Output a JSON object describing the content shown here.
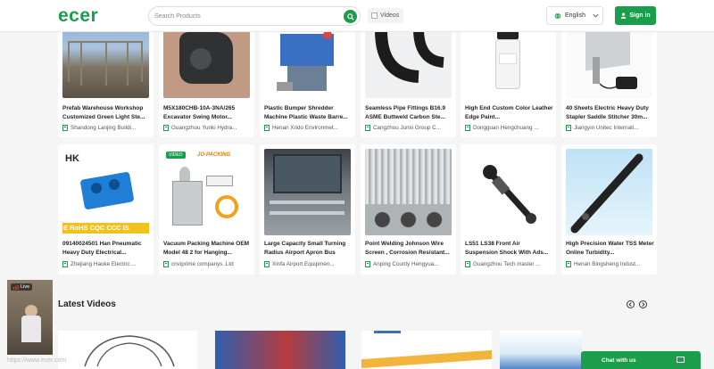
{
  "header": {
    "logo": "ecer",
    "search_placeholder": "Search Products",
    "videos_label": "Videos",
    "language": "English",
    "signin_label": "Sign in"
  },
  "products": [
    {
      "title": "Prefab Warehouse Workshop Customized Green Light Ste...",
      "supplier": "Shandong Lanjing Buildi..."
    },
    {
      "title": "M5X180CHB-10A-3NA/265 Excavator Swing Motor...",
      "supplier": "Guangzhou Yunki Hydra..."
    },
    {
      "title": "Plastic Bumper Shredder Machine Plastic Waste Barre...",
      "supplier": "Henan Xrido Environmet..."
    },
    {
      "title": "Seamless Pipe Fittings B16.9 ASME Buttweld Carbon Ste...",
      "supplier": "Cangzhou Junxi Group C..."
    },
    {
      "title": "High End Custom Color Leather Edge Paint...",
      "supplier": "Dongguan Hengchuang ..."
    },
    {
      "title": "40 Sheets Electric Heavy Duty Stapler Saddle Stitcher 30m...",
      "supplier": "Jiangyin Unitec Internati..."
    },
    {
      "title": "09140024501 Han Pneumatic Heavy Duty Electrical...",
      "supplier": "Zhejiang Haoke Electric ...",
      "img_text": "E RoHS CQC CCC IS",
      "brand": "HK"
    },
    {
      "title": "Vacuum Packing Machine OEM Model 48 2 for Hanging...",
      "supplier": "cnviprime companys .Ltd",
      "badge": "VIDEO",
      "brand": "JO-PACKING"
    },
    {
      "title": "Large Capacity Small Turning Radius Airport Apron Bus",
      "supplier": "Xinfa Airport Equipmen..."
    },
    {
      "title": "Point Welding Johnson Wire Screen , Corrosion Resistant...",
      "supplier": "Anping County Hengyua..."
    },
    {
      "title": "LS51 LS38 Front Air Suspension Shock With Ads...",
      "supplier": "Guangzhou Tech master ..."
    },
    {
      "title": "High Precision Water TSS Meter Online Turbidity...",
      "supplier": "Henan Bingsheng Indust..."
    }
  ],
  "latest_videos": {
    "title": "Latest Videos"
  },
  "live": {
    "label": "Live"
  },
  "watermark": "https://www.ecer.com",
  "chat": {
    "label": "Chat with us"
  },
  "colors": {
    "brand": "#1b9e4b"
  }
}
